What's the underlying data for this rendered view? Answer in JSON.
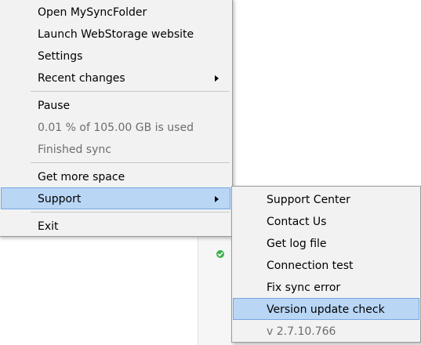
{
  "colors": {
    "menu_bg": "#f2f2f2",
    "highlight_bg": "#b9d6f5",
    "highlight_border": "#76a7e0",
    "disabled_text": "#6d6d6d",
    "status_ok": "#3bb14a"
  },
  "main_menu": {
    "open_folder": "Open MySyncFolder",
    "launch_website": "Launch WebStorage website",
    "settings": "Settings",
    "recent_changes": "Recent changes",
    "pause": "Pause",
    "usage": "0.01 % of 105.00 GB is used",
    "sync_status": "Finished sync",
    "get_more_space": "Get more space",
    "support": "Support",
    "exit": "Exit"
  },
  "support_menu": {
    "support_center": "Support Center",
    "contact_us": "Contact Us",
    "get_log_file": "Get log file",
    "connection_test": "Connection test",
    "fix_sync_error": "Fix sync error",
    "version_update_check": "Version update check",
    "version": "v 2.7.10.766"
  },
  "icons": {
    "status": "check-circle-icon",
    "submenu_arrow": "chevron-right-icon"
  }
}
